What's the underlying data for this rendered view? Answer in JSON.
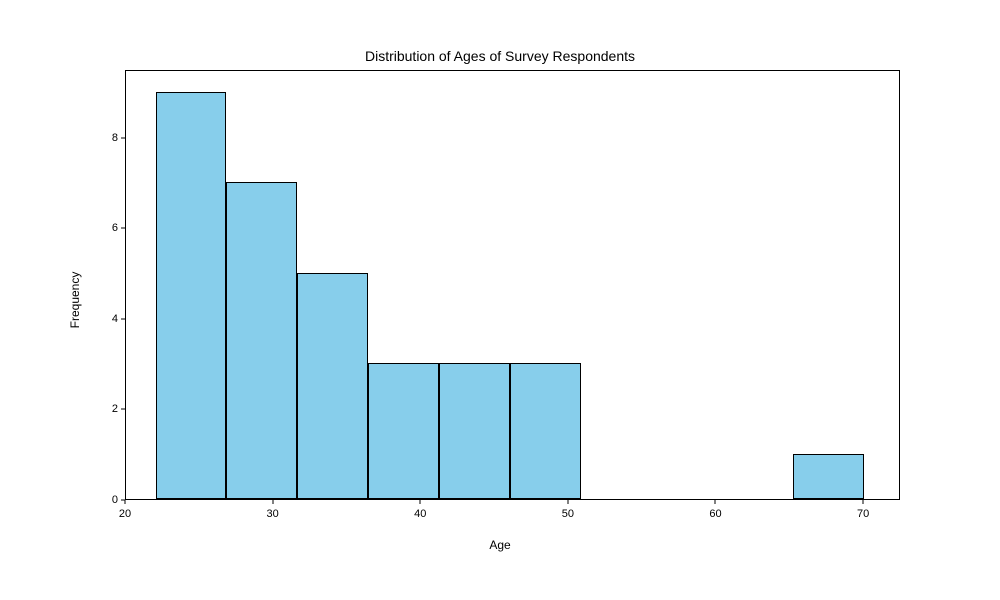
{
  "chart_data": {
    "type": "bar",
    "title": "Distribution of Ages of Survey Respondents",
    "xlabel": "Age",
    "ylabel": "Frequency",
    "xlim": [
      20,
      72.5
    ],
    "ylim": [
      0,
      9.5
    ],
    "x_ticks": [
      20,
      30,
      40,
      50,
      60,
      70
    ],
    "y_ticks": [
      0,
      2,
      4,
      6,
      8
    ],
    "bin_edges": [
      22,
      26.8,
      31.6,
      36.4,
      41.2,
      46.0,
      50.8,
      55.6,
      60.4,
      65.2,
      70
    ],
    "values": [
      9,
      7,
      5,
      3,
      3,
      3,
      0,
      0,
      0,
      1
    ],
    "categories": [
      "22–26.8",
      "26.8–31.6",
      "31.6–36.4",
      "36.4–41.2",
      "41.2–46.0",
      "46.0–50.8",
      "50.8–55.6",
      "55.6–60.4",
      "60.4–65.2",
      "65.2–70"
    ]
  }
}
